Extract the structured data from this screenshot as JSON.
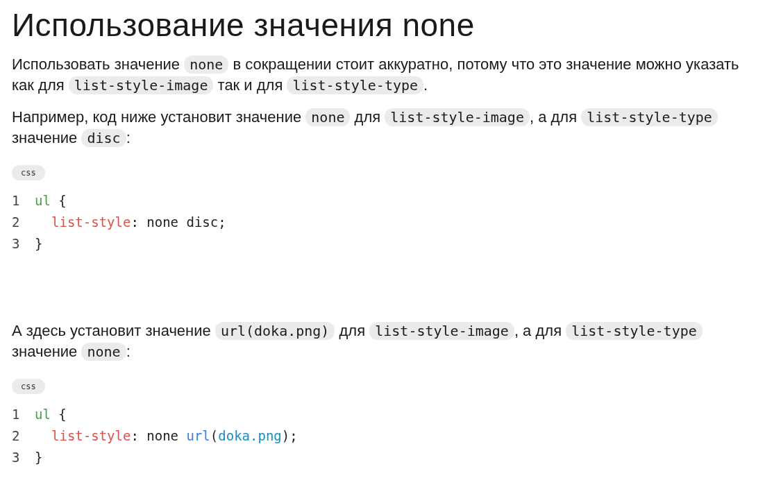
{
  "title": "Использование значения none",
  "blocks": [
    {
      "kind": "paragraph",
      "parts": [
        {
          "kind": "text",
          "text": "Использовать значение "
        },
        {
          "kind": "code",
          "text": "none"
        },
        {
          "kind": "text",
          "text": " в сокращении стоит аккуратно, потому что это значение можно указать как для "
        },
        {
          "kind": "code",
          "text": "list-style-image"
        },
        {
          "kind": "text",
          "text": " так и для "
        },
        {
          "kind": "code",
          "text": "list-style-type"
        },
        {
          "kind": "text",
          "text": "."
        }
      ]
    },
    {
      "kind": "paragraph",
      "parts": [
        {
          "kind": "text",
          "text": "Например, код ниже установит значение "
        },
        {
          "kind": "code",
          "text": "none"
        },
        {
          "kind": "text",
          "text": " для "
        },
        {
          "kind": "code",
          "text": "list-style-image"
        },
        {
          "kind": "text",
          "text": ", а для "
        },
        {
          "kind": "code",
          "text": "list-style-type"
        },
        {
          "kind": "text",
          "text": " значение "
        },
        {
          "kind": "code",
          "text": "disc"
        },
        {
          "kind": "text",
          "text": ":"
        }
      ]
    },
    {
      "kind": "code_block",
      "language": "css",
      "lines": [
        {
          "number": "1",
          "tokens": [
            {
              "kind": "selector",
              "text": "ul"
            },
            {
              "kind": "plain",
              "text": " {"
            }
          ]
        },
        {
          "number": "2",
          "indented": true,
          "tokens": [
            {
              "kind": "property",
              "text": "list-style"
            },
            {
              "kind": "plain",
              "text": ": none disc;"
            }
          ]
        },
        {
          "number": "3",
          "tokens": [
            {
              "kind": "plain",
              "text": "}"
            }
          ]
        }
      ]
    },
    {
      "kind": "paragraph",
      "parts": [
        {
          "kind": "text",
          "text": "А здесь установит значение "
        },
        {
          "kind": "code",
          "text": "url(doka.png)"
        },
        {
          "kind": "text",
          "text": " для "
        },
        {
          "kind": "code",
          "text": "list-style-image"
        },
        {
          "kind": "text",
          "text": ", а для "
        },
        {
          "kind": "code",
          "text": "list-style-type"
        },
        {
          "kind": "text",
          "text": " значение "
        },
        {
          "kind": "code",
          "text": "none"
        },
        {
          "kind": "text",
          "text": ":"
        }
      ]
    },
    {
      "kind": "code_block",
      "language": "css",
      "lines": [
        {
          "number": "1",
          "tokens": [
            {
              "kind": "selector",
              "text": "ul"
            },
            {
              "kind": "plain",
              "text": " {"
            }
          ]
        },
        {
          "number": "2",
          "indented": true,
          "tokens": [
            {
              "kind": "property",
              "text": "list-style"
            },
            {
              "kind": "plain",
              "text": ": none "
            },
            {
              "kind": "function",
              "text": "url"
            },
            {
              "kind": "plain",
              "text": "("
            },
            {
              "kind": "string",
              "text": "doka.png"
            },
            {
              "kind": "plain",
              "text": ");"
            }
          ]
        },
        {
          "number": "3",
          "tokens": [
            {
              "kind": "plain",
              "text": "}"
            }
          ]
        }
      ]
    }
  ]
}
